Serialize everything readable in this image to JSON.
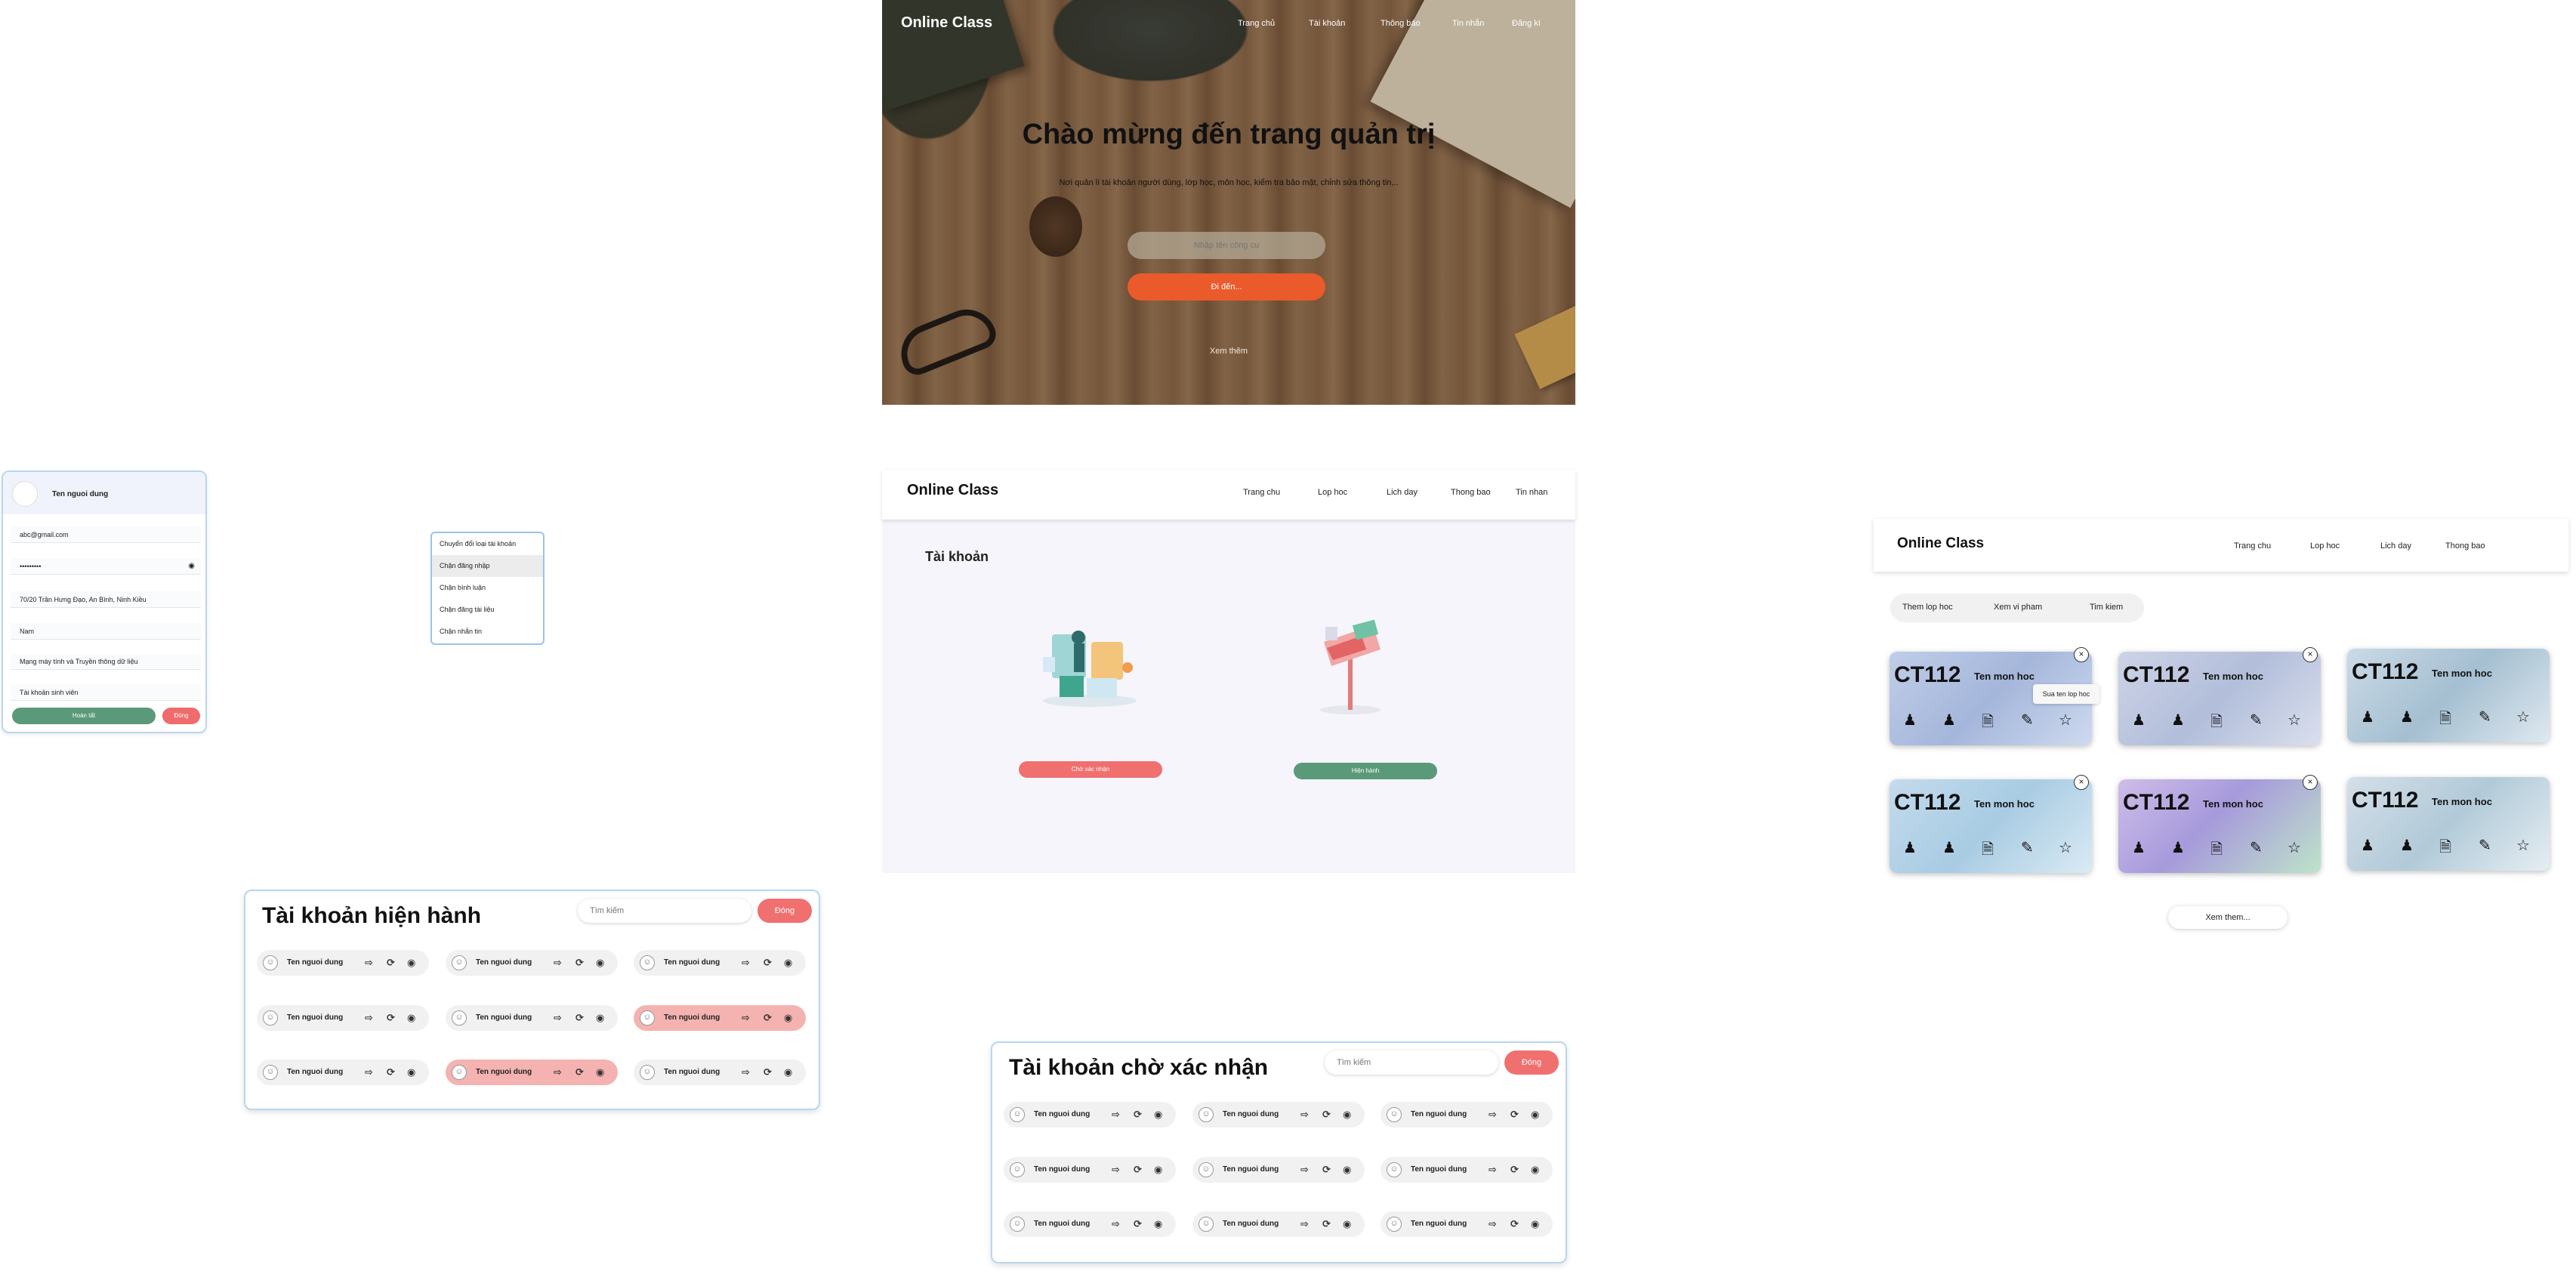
{
  "hero": {
    "brand": "Online Class",
    "nav": [
      "Trang chủ",
      "Tài khoản",
      "Thông báo",
      "Tin nhắn",
      "Đăng kí"
    ],
    "title": "Chào mừng đến trang quản trị",
    "subtitle": "Nơi quản lí tài khoản người dùng, lớp học, môn học, kiểm tra bảo mật, chỉnh sửa thông tin,..",
    "tool_placeholder": "Nhập tên công cụ",
    "go_label": "Đi đến...",
    "more_label": "Xem thêm"
  },
  "profile": {
    "name": "Ten nguoi dung",
    "email": "abc@gmail.com",
    "password": "•••••••••",
    "address": "70/20 Trần Hưng Đạo, An Bình, Ninh Kiều",
    "gender": "Nam",
    "department": "Mạng máy tính và Truyền thông dữ liệu",
    "account_type": "Tài khoản sinh viên",
    "save_label": "Hoàn tất",
    "close_label": "Đóng"
  },
  "context_menu": {
    "items": [
      "Chuyển đổi loại tài khoản",
      "Chặn đăng nhập",
      "Chặn bình luận",
      "Chặn đăng tài liệu",
      "Chặn nhắn tin"
    ]
  },
  "active_accounts": {
    "title": "Tài khoản hiện hành",
    "search_placeholder": "Tìm kiếm",
    "close_label": "Đóng",
    "user_label": "Ten nguoi dung"
  },
  "pending_accounts": {
    "title": "Tài khoản chờ xác nhận",
    "search_placeholder": "Tìm kiếm",
    "close_label": "Đóng",
    "user_label": "Ten nguoi dung"
  },
  "mid_window": {
    "brand": "Online Class",
    "nav": [
      "Trang chu",
      "Lop hoc",
      "Lich day",
      "Thong bao",
      "Tin nhan"
    ],
    "title": "Tài khoản",
    "pending_button": "Chờ xác nhận",
    "active_button": "Hiện hành"
  },
  "right_window": {
    "brand": "Online Class",
    "nav": [
      "Trang chu",
      "Lop hoc",
      "Lich day",
      "Thong bao"
    ],
    "tabs": [
      "Them lop hoc",
      "Xem vi pham",
      "Tim kiem"
    ],
    "course_code": "CT112",
    "course_name": "Ten mon hoc",
    "tooltip": "Sua ten lop hoc",
    "see_more": "Xem them..."
  },
  "colors": {
    "accent_red": "#f07070",
    "accent_green": "#5a9a7a",
    "orange": "#ea5a2a",
    "highlight_row": "#f4b3b0"
  }
}
